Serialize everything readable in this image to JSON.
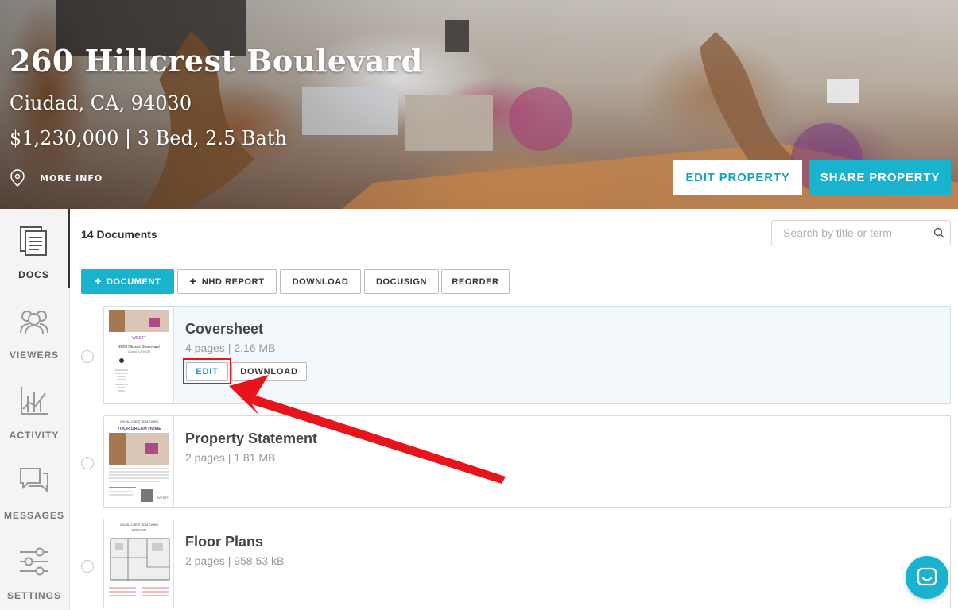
{
  "property": {
    "title": "260 Hillcrest Boulevard",
    "city_line": "Ciudad, CA, 94030",
    "price_line": "$1,230,000 | 3 Bed, 2.5 Bath",
    "more_info_label": "MORE INFO",
    "edit_button": "EDIT PROPERTY",
    "share_button": "SHARE PROPERTY"
  },
  "sidebar": {
    "items": [
      {
        "label": "DOCS",
        "icon": "docs-icon",
        "active": true
      },
      {
        "label": "VIEWERS",
        "icon": "viewers-icon"
      },
      {
        "label": "ACTIVITY",
        "icon": "activity-icon"
      },
      {
        "label": "MESSAGES",
        "icon": "messages-icon"
      },
      {
        "label": "SETTINGS",
        "icon": "settings-icon"
      }
    ]
  },
  "documents": {
    "count_label": "14 Documents",
    "search_placeholder": "Search by title or term",
    "toolbar": {
      "add_document": "DOCUMENT",
      "nhd_report": "NHD REPORT",
      "download": "DOWNLOAD",
      "docusign": "DOCUSIGN",
      "reorder": "REORDER"
    },
    "items": [
      {
        "title": "Coversheet",
        "meta": "4 pages | 2.16 MB",
        "edit_label": "EDIT",
        "download_label": "DOWNLOAD"
      },
      {
        "title": "Property Statement",
        "meta": "2 pages | 1.81 MB"
      },
      {
        "title": "Floor Plans",
        "meta": "2 pages | 958.53 kB"
      }
    ]
  },
  "thumbnails": {
    "coversheet": {
      "brand": "WESTT",
      "title": "260 Hillcrest Boulevard",
      "subtitle": "Ciudad, CA 94030"
    },
    "statement": {
      "header": "260 HILLCREST BOULEVARD",
      "banner": "YOUR DREAM HOME",
      "brand": "WESTT"
    },
    "floorplan": {
      "header": "260 HILLCREST BOULEVARD",
      "subheader": "MAIN FLOOR"
    }
  },
  "colors": {
    "accent": "#1ab3cf",
    "annotation": "#e8141b"
  }
}
